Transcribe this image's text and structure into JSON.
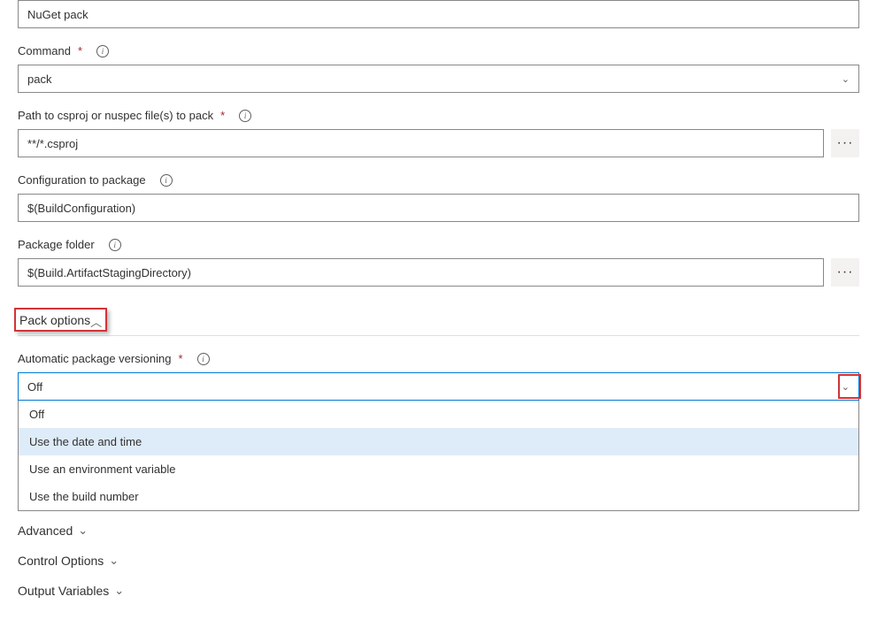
{
  "displayName": {
    "value": "NuGet pack"
  },
  "command": {
    "label": "Command",
    "value": "pack"
  },
  "path": {
    "label": "Path to csproj or nuspec file(s) to pack",
    "value": "**/*.csproj"
  },
  "configuration": {
    "label": "Configuration to package",
    "value": "$(BuildConfiguration)"
  },
  "packageFolder": {
    "label": "Package folder",
    "value": "$(Build.ArtifactStagingDirectory)"
  },
  "sections": {
    "packOptions": "Pack options",
    "advanced": "Advanced",
    "controlOptions": "Control Options",
    "outputVariables": "Output Variables"
  },
  "autoVersioning": {
    "label": "Automatic package versioning",
    "selected": "Off",
    "options": [
      "Off",
      "Use the date and time",
      "Use an environment variable",
      "Use the build number"
    ],
    "hoveredIndex": 1
  }
}
